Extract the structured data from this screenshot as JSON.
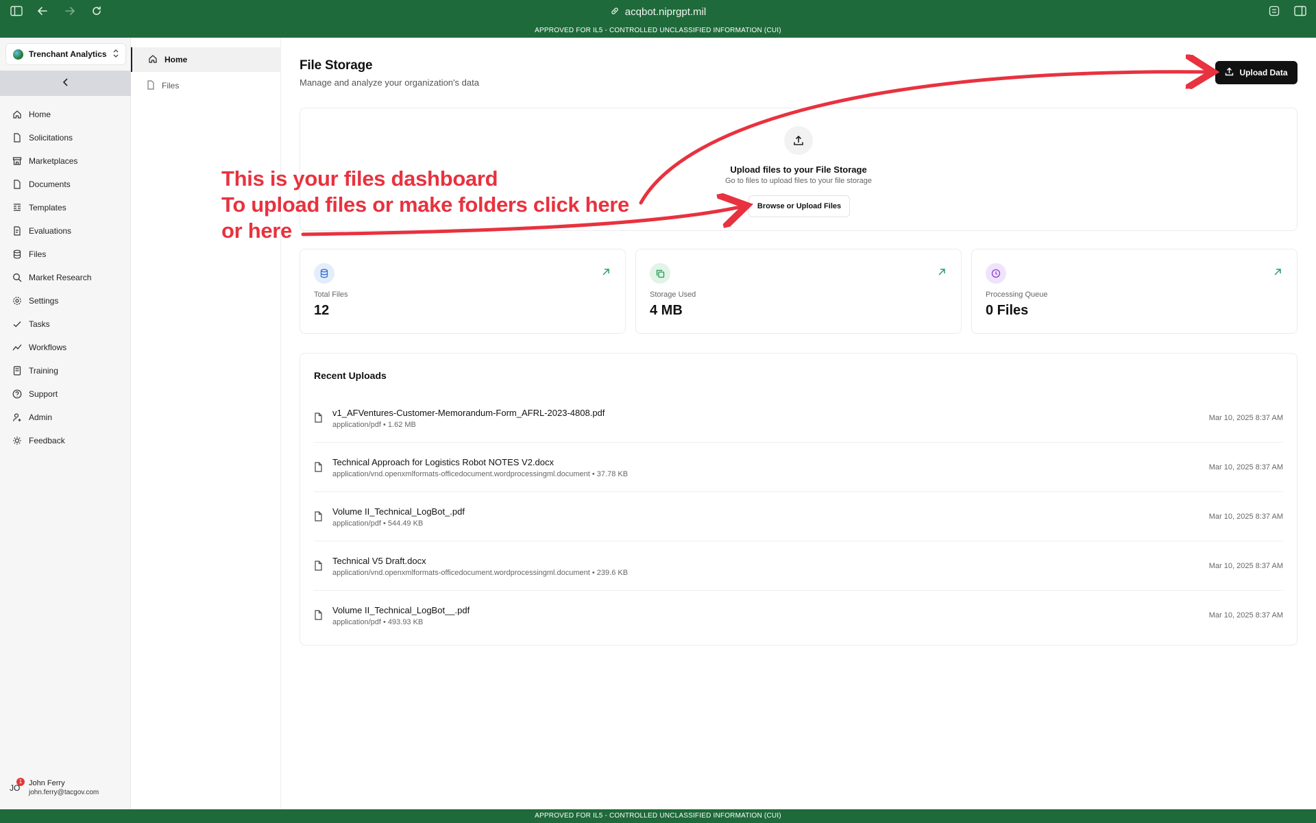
{
  "browser": {
    "url": "acqbot.niprgpt.mil"
  },
  "banner": {
    "text": "APPROVED FOR IL5 - CONTROLLED UNCLASSIFIED INFORMATION (CUI)"
  },
  "org": {
    "name": "Trenchant Analytics"
  },
  "sidebar": {
    "items": [
      {
        "label": "Home",
        "icon": "home-icon"
      },
      {
        "label": "Solicitations",
        "icon": "file-icon"
      },
      {
        "label": "Marketplaces",
        "icon": "store-icon"
      },
      {
        "label": "Documents",
        "icon": "document-icon"
      },
      {
        "label": "Templates",
        "icon": "template-icon"
      },
      {
        "label": "Evaluations",
        "icon": "clipboard-icon"
      },
      {
        "label": "Files",
        "icon": "database-icon"
      },
      {
        "label": "Market Research",
        "icon": "search-icon"
      },
      {
        "label": "Settings",
        "icon": "gear-icon"
      },
      {
        "label": "Tasks",
        "icon": "check-icon"
      },
      {
        "label": "Workflows",
        "icon": "trend-icon"
      },
      {
        "label": "Training",
        "icon": "book-icon"
      },
      {
        "label": "Support",
        "icon": "help-icon"
      },
      {
        "label": "Admin",
        "icon": "user-cog-icon"
      },
      {
        "label": "Feedback",
        "icon": "lightbulb-icon"
      }
    ]
  },
  "user": {
    "initials": "JO",
    "badge": "1",
    "name": "John Ferry",
    "email": "john.ferry@tacgov.com"
  },
  "subnav": {
    "items": [
      {
        "label": "Home"
      },
      {
        "label": "Files"
      }
    ]
  },
  "main": {
    "title": "File Storage",
    "subtitle": "Manage and analyze your organization's data",
    "upload_button": "Upload Data",
    "dropzone": {
      "title": "Upload files to your File Storage",
      "subtitle": "Go to files to upload files to your file storage",
      "button": "Browse or Upload Files"
    },
    "stats": [
      {
        "label": "Total Files",
        "value": "12",
        "color": "#2f6fd6",
        "bg": "#e4edfb"
      },
      {
        "label": "Storage Used",
        "value": "4 MB",
        "color": "#1f9a4e",
        "bg": "#e1f4e7"
      },
      {
        "label": "Processing Queue",
        "value": "0 Files",
        "color": "#8a3fd1",
        "bg": "#efe4fb"
      }
    ],
    "recent": {
      "title": "Recent Uploads",
      "rows": [
        {
          "name": "v1_AFVentures-Customer-Memorandum-Form_AFRL-2023-4808.pdf",
          "meta": "application/pdf • 1.62 MB",
          "date": "Mar 10, 2025 8:37 AM"
        },
        {
          "name": "Technical Approach for Logistics Robot NOTES V2.docx",
          "meta": "application/vnd.openxmlformats-officedocument.wordprocessingml.document • 37.78 KB",
          "date": "Mar 10, 2025 8:37 AM"
        },
        {
          "name": "Volume II_Technical_LogBot_.pdf",
          "meta": "application/pdf • 544.49 KB",
          "date": "Mar 10, 2025 8:37 AM"
        },
        {
          "name": "Technical V5 Draft.docx",
          "meta": "application/vnd.openxmlformats-officedocument.wordprocessingml.document • 239.6 KB",
          "date": "Mar 10, 2025 8:37 AM"
        },
        {
          "name": "Volume II_Technical_LogBot__.pdf",
          "meta": "application/pdf • 493.93 KB",
          "date": "Mar 10, 2025 8:37 AM"
        }
      ]
    }
  },
  "annotation": {
    "lines": [
      "This is your files dashboard",
      "To upload files or make folders click here",
      "or here"
    ],
    "color": "#e8323f"
  }
}
